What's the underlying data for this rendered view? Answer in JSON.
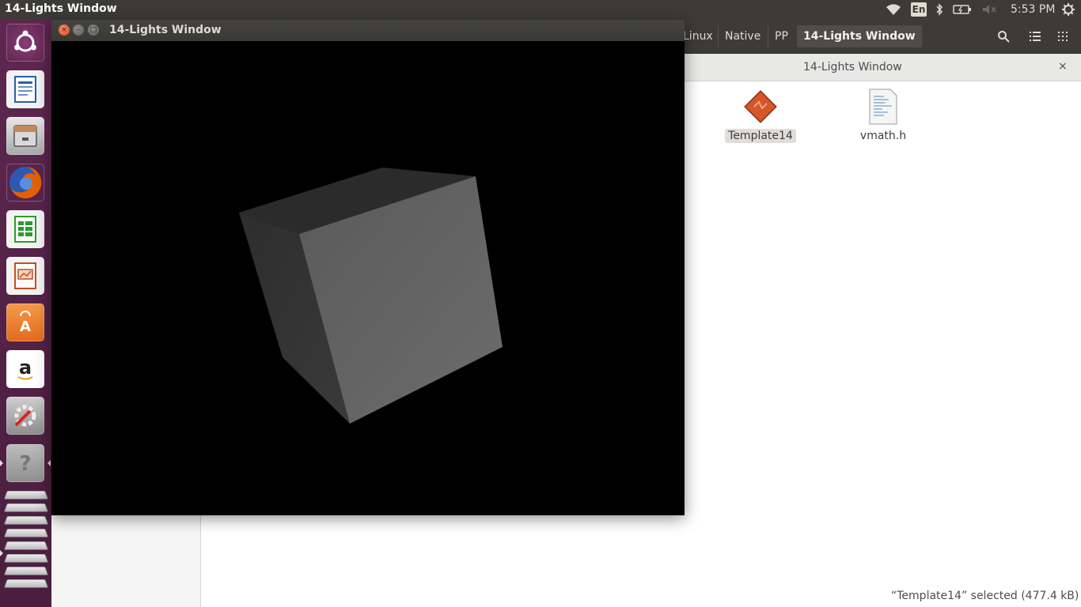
{
  "top_panel": {
    "app_title": "14-Lights Window",
    "indicators": [
      "wifi-icon",
      "keyboard-layout",
      "bluetooth-icon",
      "battery-icon",
      "volume-muted-icon"
    ],
    "keyboard_layout": "En",
    "clock": "5:53 PM",
    "session_icon": "gear-icon"
  },
  "launcher": {
    "items": [
      {
        "name": "ubuntu-dash",
        "icon": "ubuntu-logo-icon",
        "color": "#dd4814"
      },
      {
        "name": "libreoffice-writer",
        "icon": "writer-icon",
        "color": "#2a5fa7"
      },
      {
        "name": "files",
        "icon": "file-cabinet-icon",
        "color": "#8a8a8a"
      },
      {
        "name": "firefox",
        "icon": "firefox-icon",
        "color": "#e66000"
      },
      {
        "name": "libreoffice-calc",
        "icon": "calc-icon",
        "color": "#2d9a2d"
      },
      {
        "name": "libreoffice-impress",
        "icon": "impress-icon",
        "color": "#c2501f"
      },
      {
        "name": "ubuntu-software",
        "icon": "shopping-bag-icon",
        "color": "#f07c2b"
      },
      {
        "name": "amazon",
        "icon": "amazon-icon",
        "color": "#ffffff"
      },
      {
        "name": "system-settings",
        "icon": "settings-wrench-icon",
        "color": "#9a9a9a"
      },
      {
        "name": "help",
        "icon": "question-icon",
        "color": "#8a8a8a"
      }
    ],
    "stacked_windows_count": 8
  },
  "file_manager": {
    "breadcrumbs": [
      "Linux",
      "Native",
      "PP",
      "14-Lights Window"
    ],
    "active_crumb": "14-Lights Window",
    "toolbar_icons": [
      "search-icon",
      "list-view-icon",
      "grid-view-icon"
    ],
    "tab_title": "14-Lights Window",
    "tab_close": "×",
    "files": [
      {
        "name": "Template14",
        "icon": "executable-icon",
        "selected": true
      },
      {
        "name": "vmath.h",
        "icon": "text-file-icon",
        "selected": false
      }
    ],
    "status": "“Template14” selected  (477.4 kB)"
  },
  "gl_window": {
    "title": "14-Lights Window",
    "buttons": {
      "close": "×",
      "minimize": "–",
      "maximize": "□"
    },
    "background": "#000000"
  }
}
